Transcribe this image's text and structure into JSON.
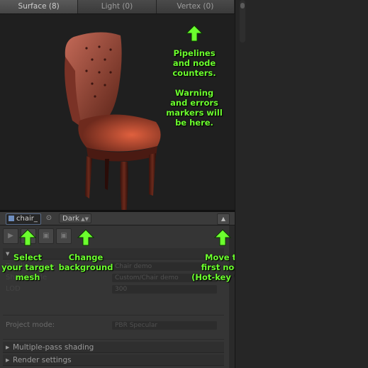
{
  "tabs": [
    "Surface (8)",
    "Light (0)",
    "Vertex (0)"
  ],
  "annotations": {
    "pipelines": "Pipelines\nand node\ncounters.\n\nWarning\nand errors\nmarkers will\nbe here.",
    "select_mesh": "Select\nyour target\nmesh",
    "change_background": "Change\nbackground",
    "move_first_node": "Move to\nfirst node\n(Hot-key “N”)"
  },
  "toolbar": {
    "mesh_value": "chair_",
    "background_value": "Dark"
  },
  "inspector": {
    "faded_labels": [
      "Pipeline name",
      "Shader title",
      "LOD"
    ],
    "faded_values": [
      "Chair demo",
      "Custom/Chair demo",
      "300"
    ],
    "project_mode_label": "Project mode:",
    "project_mode_value": "PBR Specular",
    "sections": [
      "Multiple-pass shading",
      "Render settings"
    ]
  },
  "colors": {
    "annotation": "#6cff2e",
    "panel_bg": "#1d1d1d",
    "editor_bg": "#262626"
  }
}
